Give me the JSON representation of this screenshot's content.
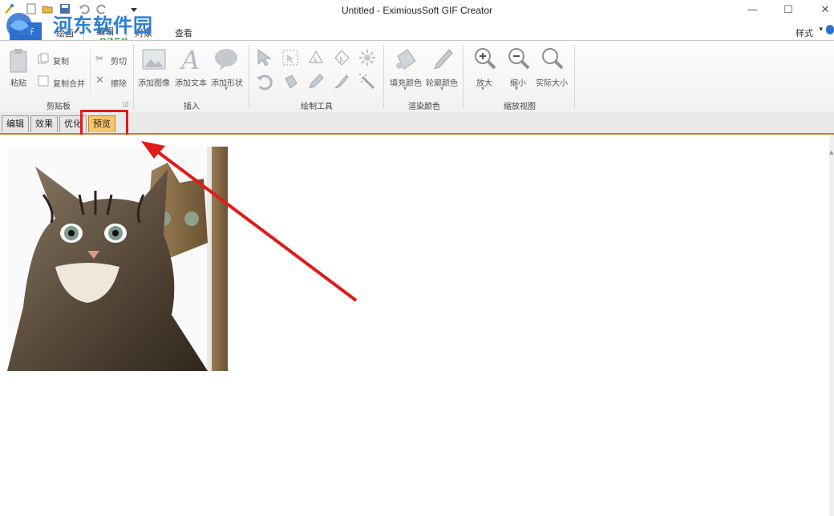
{
  "window": {
    "title": "Untitled - EximiousSoft GIF Creator",
    "controls": {
      "minimize": "—",
      "maximize": "☐",
      "close": "✕"
    }
  },
  "watermark": {
    "brand": "河东软件园",
    "url": "www.pc0359.cn"
  },
  "ribbon_tabs": {
    "file": "文件",
    "draw": "绘画",
    "edit": "编辑",
    "object": "对象",
    "view": "查看",
    "style_menu": "样式"
  },
  "ribbon": {
    "clipboard": {
      "label": "剪贴板",
      "paste": "粘贴",
      "copy": "复制",
      "copy_merge": "复制合并",
      "cut": "剪切",
      "erase": "擦除"
    },
    "insert": {
      "label": "插入",
      "add_image": "添加图像",
      "add_text": "添加文本",
      "add_shape": "添加形状"
    },
    "draw_tools": {
      "label": "绘制工具"
    },
    "render_color": {
      "label": "渲染颜色",
      "fill_color": "填充颜色",
      "outline_color": "轮廓颜色"
    },
    "zoom_view": {
      "label": "缩放视图",
      "zoom_in": "放大",
      "zoom_out": "缩小",
      "actual_size": "实际大小"
    }
  },
  "sheet_tabs": [
    "编辑",
    "效果",
    "优化",
    "预览"
  ],
  "active_sheet_tab": "预览",
  "colors": {
    "highlight": "#e01b1b",
    "accent": "#2b6fcf",
    "active_tab": "#f7c56a"
  }
}
